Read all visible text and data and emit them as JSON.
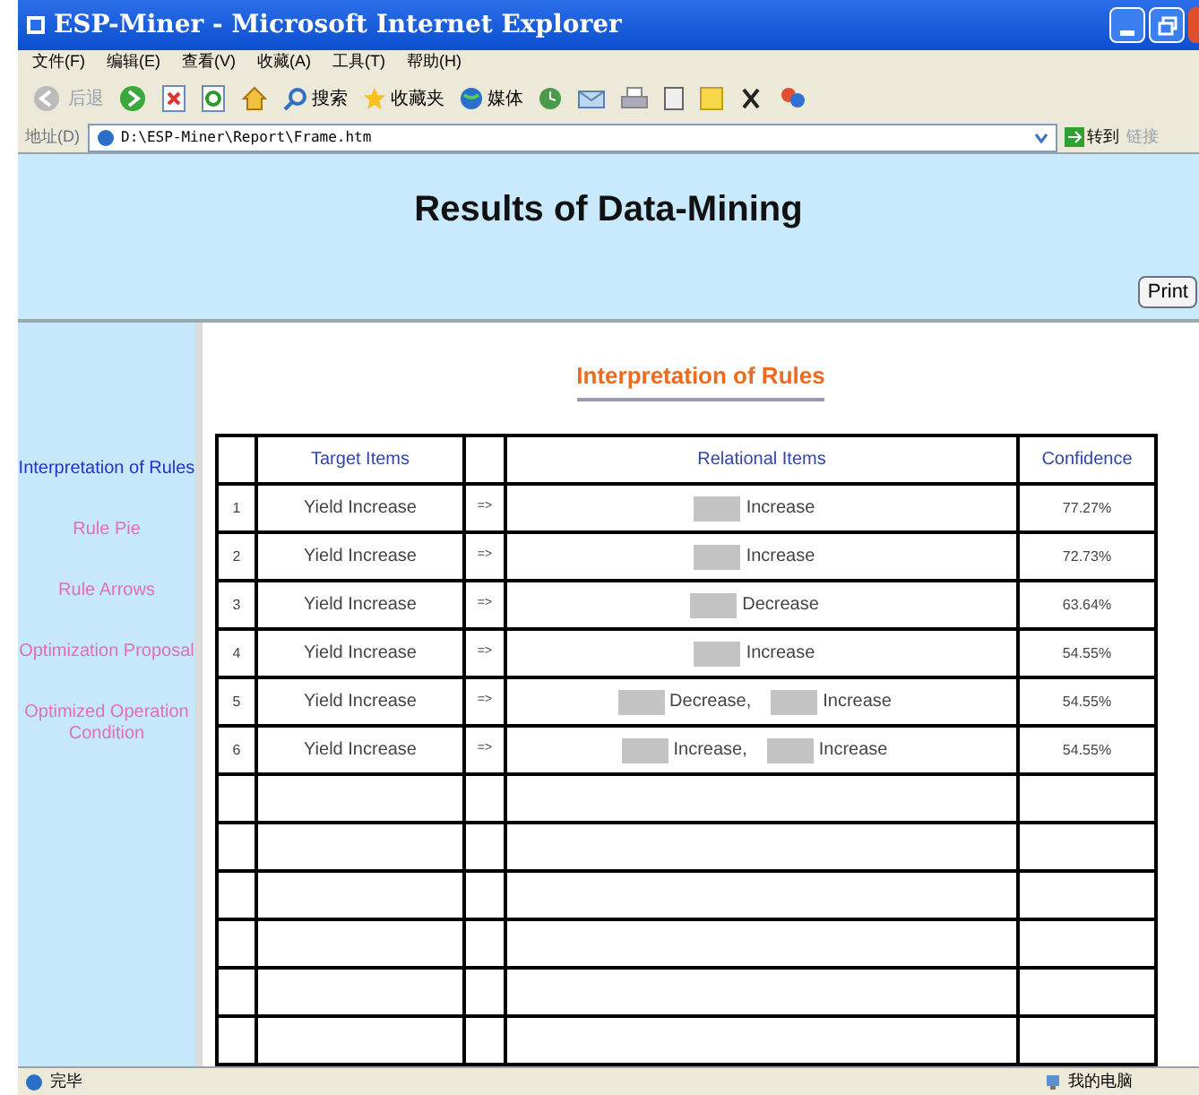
{
  "window": {
    "title": "ESP-Miner - Microsoft Internet Explorer"
  },
  "menu": [
    "文件(F)",
    "编辑(E)",
    "查看(V)",
    "收藏(A)",
    "工具(T)",
    "帮助(H)"
  ],
  "toolbar": {
    "back": "后退",
    "search": "搜索",
    "favorites": "收藏夹",
    "media": "媒体"
  },
  "address": {
    "label": "地址(D)",
    "value": "D:\\ESP-Miner\\Report\\Frame.htm",
    "go": "转到",
    "links": "链接"
  },
  "page": {
    "title": "Results of Data-Mining",
    "print": "Print"
  },
  "sidebar": {
    "items": [
      {
        "label": "Interpretation of Rules",
        "selected": true
      },
      {
        "label": "Rule Pie",
        "selected": false
      },
      {
        "label": "Rule Arrows",
        "selected": false
      },
      {
        "label": "Optimization Proposal",
        "selected": false
      },
      {
        "label": "Optimized Operation Condition",
        "selected": false
      }
    ]
  },
  "section_title": "Interpretation of Rules",
  "table": {
    "columns": [
      "Target Items",
      "Relational Items",
      "Confidence"
    ],
    "rows": [
      {
        "number": "1",
        "target": "Yield Increase",
        "arrow": "=>",
        "relational": [
          {
            "kind": "redacted"
          },
          {
            "kind": "text",
            "text": "Increase"
          }
        ],
        "confidence": "77.27%"
      },
      {
        "number": "2",
        "target": "Yield Increase",
        "arrow": "=>",
        "relational": [
          {
            "kind": "redacted"
          },
          {
            "kind": "text",
            "text": "Increase"
          }
        ],
        "confidence": "72.73%"
      },
      {
        "number": "3",
        "target": "Yield Increase",
        "arrow": "=>",
        "relational": [
          {
            "kind": "redacted"
          },
          {
            "kind": "text",
            "text": "Decrease"
          }
        ],
        "confidence": "63.64%"
      },
      {
        "number": "4",
        "target": "Yield Increase",
        "arrow": "=>",
        "relational": [
          {
            "kind": "redacted"
          },
          {
            "kind": "text",
            "text": "Increase"
          }
        ],
        "confidence": "54.55%"
      },
      {
        "number": "5",
        "target": "Yield Increase",
        "arrow": "=>",
        "relational": [
          {
            "kind": "redacted"
          },
          {
            "kind": "text",
            "text": "Decrease,"
          },
          {
            "kind": "redacted"
          },
          {
            "kind": "text",
            "text": "Increase"
          }
        ],
        "confidence": "54.55%"
      },
      {
        "number": "6",
        "target": "Yield Increase",
        "arrow": "=>",
        "relational": [
          {
            "kind": "redacted"
          },
          {
            "kind": "text",
            "text": "Increase,"
          },
          {
            "kind": "redacted"
          },
          {
            "kind": "text",
            "text": "Increase"
          }
        ],
        "confidence": "54.55%"
      }
    ]
  },
  "status_bar": {
    "status": "完毕",
    "zone": "我的电脑"
  }
}
